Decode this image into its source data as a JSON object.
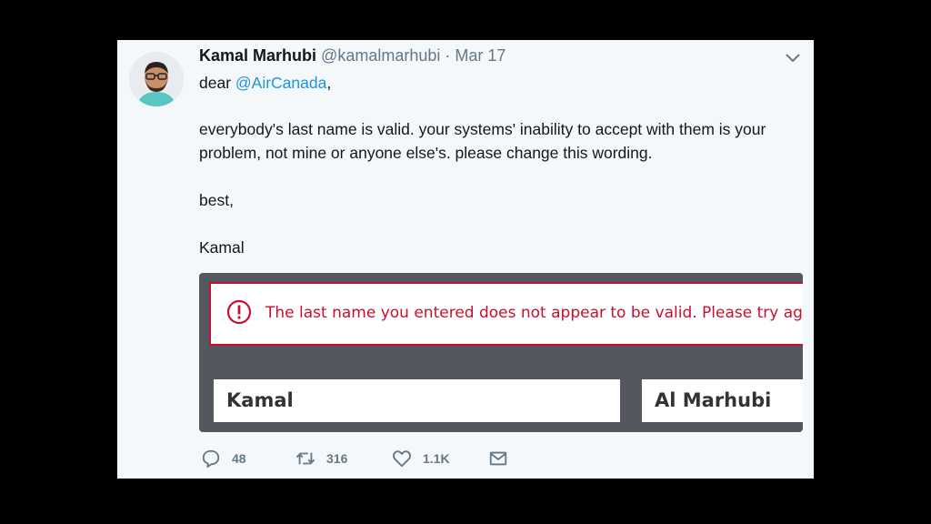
{
  "tweet": {
    "author_name": "Kamal Marhubi",
    "handle": "@kamalmarhubi",
    "separator": "·",
    "date": "Mar 17",
    "greeting_prefix": "dear ",
    "mention": "@AirCanada",
    "greeting_suffix": ",",
    "paragraph": "everybody's last name is valid. your systems' inability to accept with them is your problem, not mine or anyone else's. please change this wording.",
    "signoff": "best,",
    "signature": "Kamal"
  },
  "media": {
    "error_message": "The last name you entered does not appear to be valid. Please try again.",
    "first_name_value": "Kamal",
    "last_name_value": "Al Marhubi"
  },
  "actions": {
    "reply_count": "48",
    "retweet_count": "316",
    "like_count": "1.1K"
  },
  "colors": {
    "mention": "#1b95e0",
    "error": "#c8102e",
    "card_background": "#f5f8fa",
    "media_background": "#55575e"
  },
  "icons": [
    "chevron-down-icon",
    "alert-circle-icon",
    "reply-icon",
    "retweet-icon",
    "heart-icon",
    "message-icon"
  ]
}
